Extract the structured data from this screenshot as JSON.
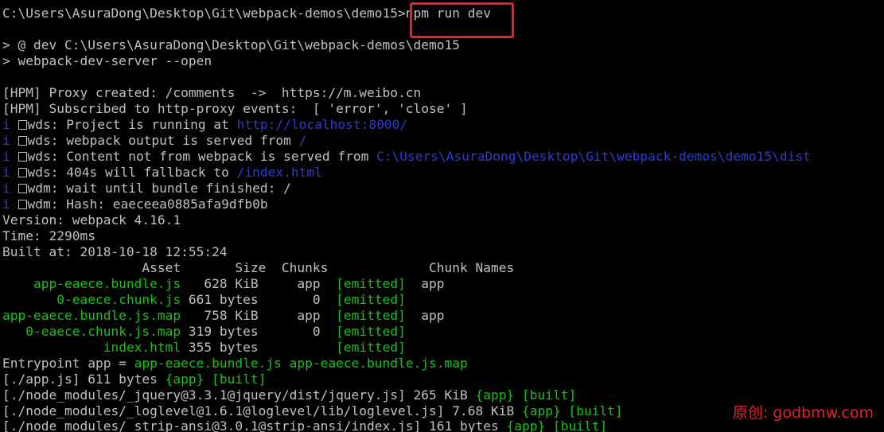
{
  "terminal": {
    "lines": [
      "C:\\Users\\AsuraDong\\Desktop\\Git\\webpack-demos\\demo15>npm run dev",
      "",
      "> @ dev C:\\Users\\AsuraDong\\Desktop\\Git\\webpack-demos\\demo15",
      "> webpack-dev-server --open",
      "",
      "[HPM] Proxy created: /comments  ->  https://m.weibo.cn",
      "[HPM] Subscribed to http-proxy events:  [ 'error', 'close' ]"
    ],
    "wds_lines": [
      {
        "prefix": "i",
        "tag": "wds:",
        "text": " Project is running at ",
        "link": "http://localhost:8000/"
      },
      {
        "prefix": "i",
        "tag": "wds:",
        "text": " webpack output is served from ",
        "link": "/"
      },
      {
        "prefix": "i",
        "tag": "wds:",
        "text": " Content not from webpack is served from ",
        "link": "C:\\Users\\AsuraDong\\Desktop\\Git\\webpack-demos\\demo15\\dist"
      },
      {
        "prefix": "i",
        "tag": "wds:",
        "text": " 404s will fallback to ",
        "link": "/index.html"
      },
      {
        "prefix": "i",
        "tag": "wdm:",
        "text": " wait until bundle finished: /",
        "link": ""
      },
      {
        "prefix": "i",
        "tag": "wdm:",
        "text": " Hash: eaeceea0885afa9dfb0b",
        "link": ""
      }
    ],
    "build_info": [
      "Version: webpack 4.16.1",
      "Time: 2290ms",
      "Built at: 2018-10-18 12:55:24"
    ],
    "table_header": "                  Asset       Size  Chunks             Chunk Names",
    "assets": [
      {
        "pad": "    ",
        "name": "app-eaece.bundle.js",
        "size": "   628 KiB",
        "chunks": "     app",
        "status": "[emitted]",
        "chunk_name": "  app"
      },
      {
        "pad": "       ",
        "name": "0-eaece.chunk.js",
        "size": " 661 bytes",
        "chunks": "       0",
        "status": "[emitted]",
        "chunk_name": ""
      },
      {
        "pad": "",
        "name": "app-eaece.bundle.js.map",
        "size": "   758 KiB",
        "chunks": "     app",
        "status": "[emitted]",
        "chunk_name": "  app"
      },
      {
        "pad": "   ",
        "name": "0-eaece.chunk.js.map",
        "size": " 319 bytes",
        "chunks": "       0",
        "status": "[emitted]",
        "chunk_name": ""
      },
      {
        "pad": "             ",
        "name": "index.html",
        "size": " 355 bytes",
        "chunks": "        ",
        "status": "[emitted]",
        "chunk_name": ""
      }
    ],
    "entrypoint": {
      "label": "Entrypoint app = ",
      "files": "app-eaece.bundle.js app-eaece.bundle.js.map"
    },
    "modules": [
      {
        "path": "[./app.js] 611 bytes ",
        "chunk": "{app}",
        "built": "[built]"
      },
      {
        "path": "[./node_modules/_jquery@3.3.1@jquery/dist/jquery.js] 265 KiB ",
        "chunk": "{app}",
        "built": "[built]"
      },
      {
        "path": "[./node_modules/_loglevel@1.6.1@loglevel/lib/loglevel.js] 7.68 KiB ",
        "chunk": "{app}",
        "built": "[built]"
      },
      {
        "path": "[./node_modules/_strip-ansi@3.0.1@strip-ansi/index.js] 161 bytes ",
        "chunk": "{app}",
        "built": "[built]"
      }
    ],
    "watermark": "原创: godbmw.com"
  },
  "colors": {
    "background": "#000000",
    "text": "#c0c0c0",
    "success": "#13c613",
    "link": "#2c3cd2",
    "highlight": "#e8202a"
  }
}
